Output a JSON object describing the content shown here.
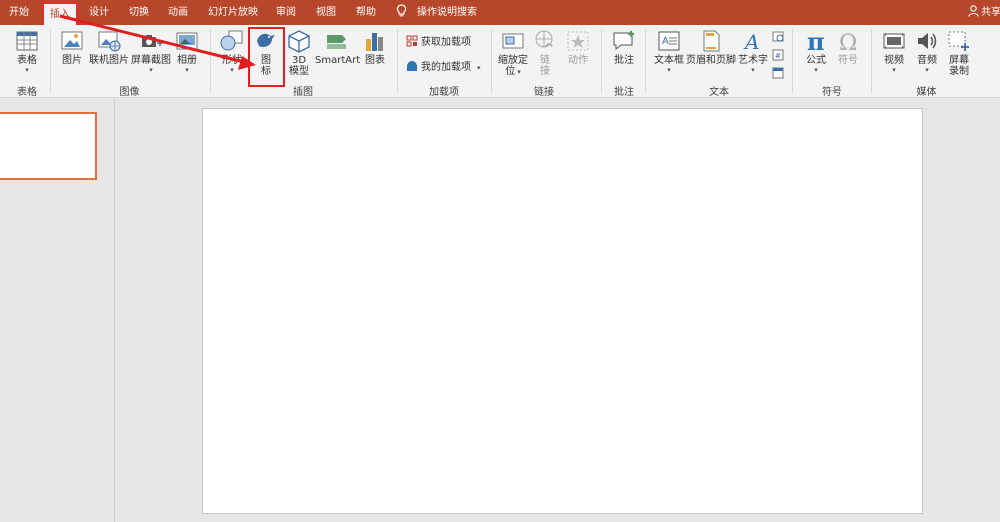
{
  "tabs": {
    "home": "开始",
    "insert": "插入",
    "design": "设计",
    "transitions": "切换",
    "animations": "动画",
    "slideshow": "幻灯片放映",
    "review": "审阅",
    "view": "视图",
    "help": "帮助"
  },
  "tell_me": "操作说明搜索",
  "share": "共享",
  "ribbon": {
    "table": {
      "button": "表格",
      "group": "表格"
    },
    "images": {
      "picture": "图片",
      "online_picture": "联机图片",
      "screenshot": "屏幕截图",
      "album": "相册",
      "group": "图像"
    },
    "illustrations": {
      "shapes": "形状",
      "icons_line1": "图",
      "icons_line2": "标",
      "model3d_line1": "3D",
      "model3d_line2": "模型",
      "smartart": "SmartArt",
      "chart": "图表",
      "group": "插图"
    },
    "addins": {
      "get_addins": "获取加载项",
      "my_addins": "我的加载项",
      "group": "加载项"
    },
    "links": {
      "zoom_line1": "缩放定",
      "zoom_line2": "位",
      "link_line1": "链",
      "link_line2": "接",
      "action": "动作",
      "group": "链接"
    },
    "comments": {
      "comment": "批注",
      "group": "批注"
    },
    "text": {
      "textbox": "文本框",
      "header_footer": "页眉和页脚",
      "wordart": "艺术字",
      "group": "文本"
    },
    "symbols": {
      "equation": "公式",
      "symbol": "符号",
      "group": "符号"
    },
    "media": {
      "video": "视频",
      "audio": "音频",
      "screen_rec_line1": "屏幕",
      "screen_rec_line2": "录制",
      "group": "媒体"
    }
  },
  "colors": {
    "accent": "#b7472a",
    "annotation": "#e02020"
  }
}
